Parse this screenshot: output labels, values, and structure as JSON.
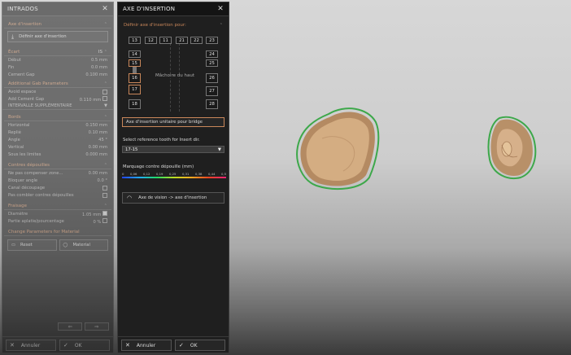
{
  "intrados": {
    "title": "INTRADOS",
    "axis_section": "Axe d'insertion",
    "define_axis_button": "Définir axe d'insertion",
    "ecart_section": "Écart",
    "ecart_value": "IS",
    "debut": {
      "label": "Début",
      "value": "0.5",
      "unit": "mm"
    },
    "fin": {
      "label": "Fin",
      "value": "0.0",
      "unit": "mm"
    },
    "cement_gap": {
      "label": "Cement Gap",
      "value": "0.100",
      "unit": "mm"
    },
    "additional_section": "Additional Gab Parameters",
    "avoid_label": "Avoid espace",
    "add_cement_label": "Add Cement Gap",
    "add_cement_value": "0.110",
    "add_cement_unit": "mm",
    "intervalle": "INTERVALLE SUPPLÉMENTAIRE",
    "bords_section": "Bords",
    "horizontal": {
      "label": "Horizontal",
      "value": "0.150",
      "unit": "mm"
    },
    "replie": {
      "label": "Replié",
      "value": "0.10",
      "unit": "mm"
    },
    "angle": {
      "label": "Angle",
      "value": "45",
      "unit": "°"
    },
    "vertical": {
      "label": "Vertical",
      "value": "0.00",
      "unit": "mm"
    },
    "sous_limites": {
      "label": "Sous les limites",
      "value": "0.000",
      "unit": "mm"
    },
    "contres_section": "Contres dépouilles",
    "ne_pas": {
      "label": "Ne pas compenser zone...",
      "value": "0.00",
      "unit": "mm"
    },
    "bloquer": {
      "label": "Bloquer angle",
      "value": "0.0",
      "unit": "°"
    },
    "canal": "Canal découpage",
    "pas_combler": "Pas combler contres dépouilles",
    "fraisage_section": "Fraisage",
    "diametre": {
      "label": "Diamètre",
      "value": "1.05",
      "unit": "mm"
    },
    "partie": {
      "label": "Partie aplatie/pourcentage",
      "value": "0",
      "unit": "%"
    },
    "change_section": "Change Parameters for Material",
    "reset": "Reset",
    "material": "Material",
    "annuler": "Annuler",
    "ok": "OK"
  },
  "axe": {
    "title": "AXE D'INSERTION",
    "define_label": "Définir axe d'insertion pour:",
    "top_teeth": [
      "13",
      "12",
      "11",
      "21",
      "22",
      "23"
    ],
    "left_teeth": [
      "14",
      "15",
      "16",
      "17",
      "18"
    ],
    "right_teeth": [
      "24",
      "25",
      "26",
      "27",
      "28"
    ],
    "jaw_label": "Mâchoire du haut",
    "bridge_button": "Axe d'insertion unitaire pour bridge",
    "ref_label": "Select reference tooth for Insert dir.",
    "ref_value": "17-15",
    "marquage_label": "Marquage contre dépouille (mm)",
    "scale_ticks": [
      "0",
      "0,06",
      "0,12",
      "0,19",
      "0,25",
      "0,31",
      "0,38",
      "0,44",
      "0,5"
    ],
    "vision_button": "Axe de vision -> axe d'insertion",
    "annuler": "Annuler",
    "ok": "OK"
  },
  "colors": {
    "accent": "#c9875a",
    "panel_bg": "#1f1f1f",
    "tooth": "#c9a47a",
    "outline": "#3da84a"
  }
}
